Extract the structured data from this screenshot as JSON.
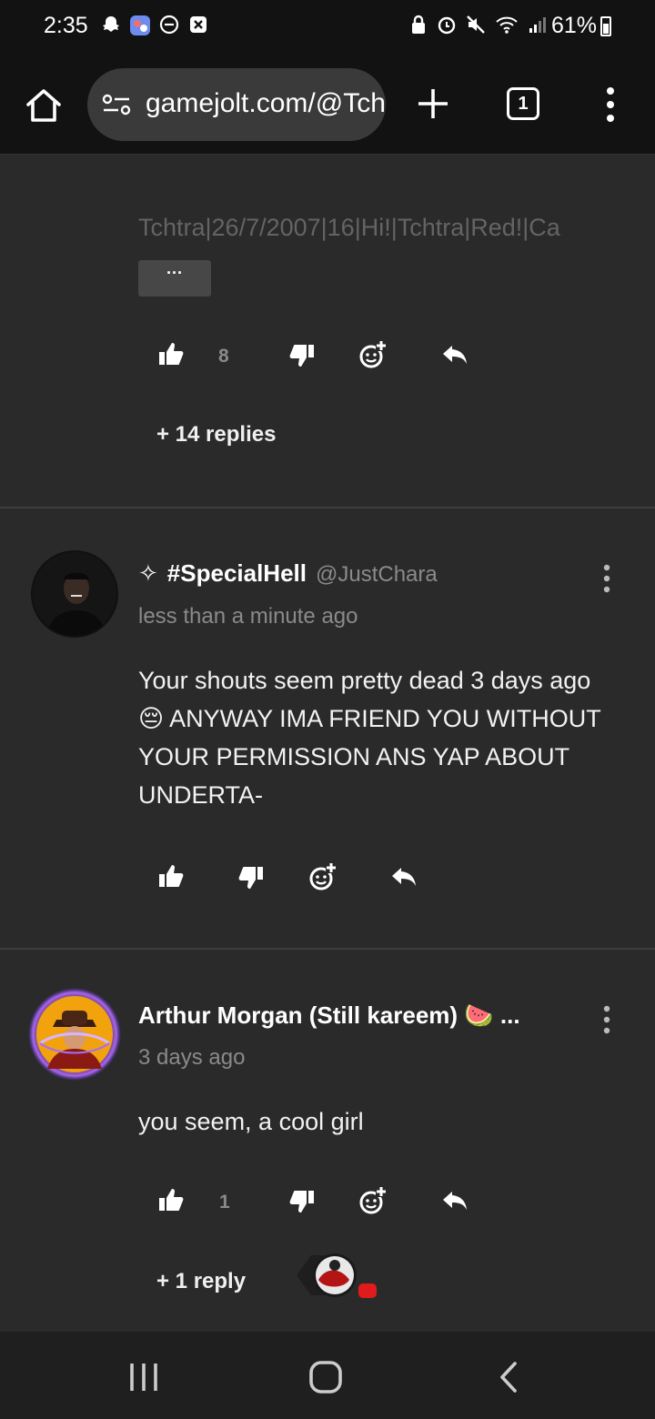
{
  "status_bar": {
    "time": "2:35",
    "battery": "61%"
  },
  "browser": {
    "url": "gamejolt.com/@Tchtra",
    "tab_count": "1"
  },
  "comments": [
    {
      "truncated_text": "Tchtra|26/7/2007|16|Hi!|Tchtra|Red!|Ca",
      "expand_label": "···",
      "likes": "8",
      "replies_label": "+ 14 replies"
    },
    {
      "sparkle": "✧",
      "display_name": "#SpecialHell",
      "handle": "@JustChara",
      "timestamp": "less than a minute ago",
      "body": "Your shouts seem pretty dead 3 days ago 😔 ANYWAY IMA FRIEND YOU WITHOUT YOUR PERMISSION ANS YAP ABOUT UNDERTA-"
    },
    {
      "display_name": "Arthur Morgan (Still kareem) 🍉 ...",
      "timestamp": "3 days ago",
      "body": "you seem, a cool girl",
      "likes": "1",
      "replies_label": "+ 1 reply"
    }
  ],
  "colors": {
    "background": "#2a2a2a",
    "bar": "#121212",
    "muted": "#8a8a8a",
    "text": "#f2f2f2"
  }
}
